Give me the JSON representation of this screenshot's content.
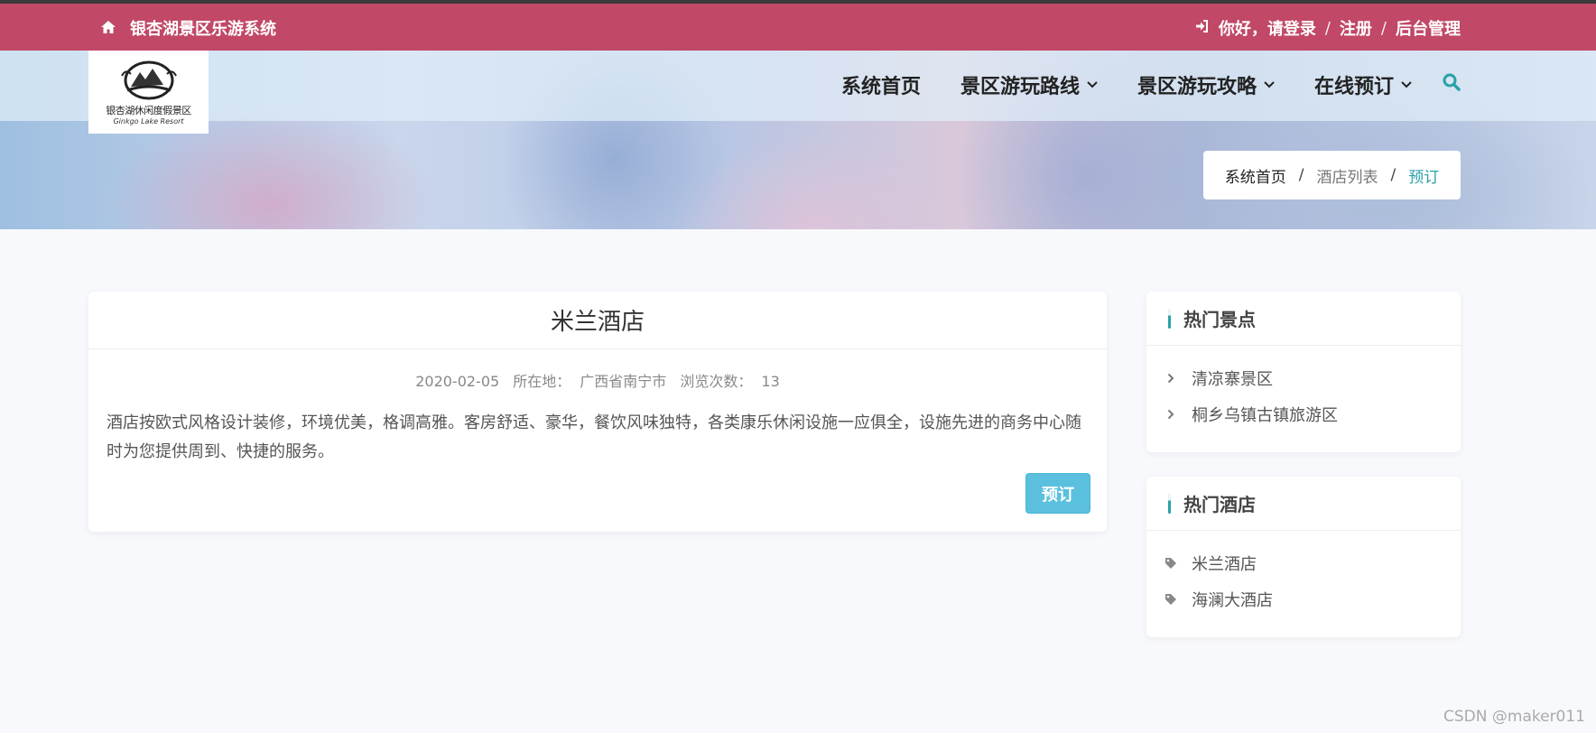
{
  "topbar": {
    "home_icon": "home-icon",
    "site_title": "银杏湖景区乐游系统",
    "login_icon": "sign-in-icon",
    "login_label": "你好，请登录",
    "register_label": "注册",
    "admin_label": "后台管理",
    "separator": "/",
    "bg_color": "#c14866"
  },
  "logo": {
    "text": "银杏湖休闲度假景区",
    "sub": "Ginkgo Lake Resort"
  },
  "nav": {
    "items": [
      {
        "label": "系统首页"
      },
      {
        "label": "景区游玩路线"
      },
      {
        "label": "景区游玩攻略"
      },
      {
        "label": "在线预订"
      }
    ],
    "search_icon": "search-icon",
    "accent": "#2aa1a8"
  },
  "breadcrumb": {
    "home": "系统首页",
    "list": "酒店列表",
    "current": "预订",
    "separator": "/"
  },
  "hotel": {
    "name": "米兰酒店",
    "date": "2020-02-05",
    "location_label": "所在地：",
    "location": "广西省南宁市",
    "views_label": "浏览次数：",
    "views": "13",
    "description": "酒店按欧式风格设计装修，环境优美，格调高雅。客房舒适、豪华，餐饮风味独特，各类康乐休闲设施一应俱全，设施先进的商务中心随时为您提供周到、快捷的服务。",
    "book_label": "预订",
    "book_color": "#5bc0de"
  },
  "sidebar": {
    "attractions": {
      "title": "热门景点",
      "items": [
        {
          "label": "清凉寨景区"
        },
        {
          "label": "桐乡乌镇古镇旅游区"
        }
      ]
    },
    "hotels": {
      "title": "热门酒店",
      "items": [
        {
          "label": "米兰酒店"
        },
        {
          "label": "海澜大酒店"
        }
      ]
    }
  },
  "watermark": "CSDN @maker011"
}
